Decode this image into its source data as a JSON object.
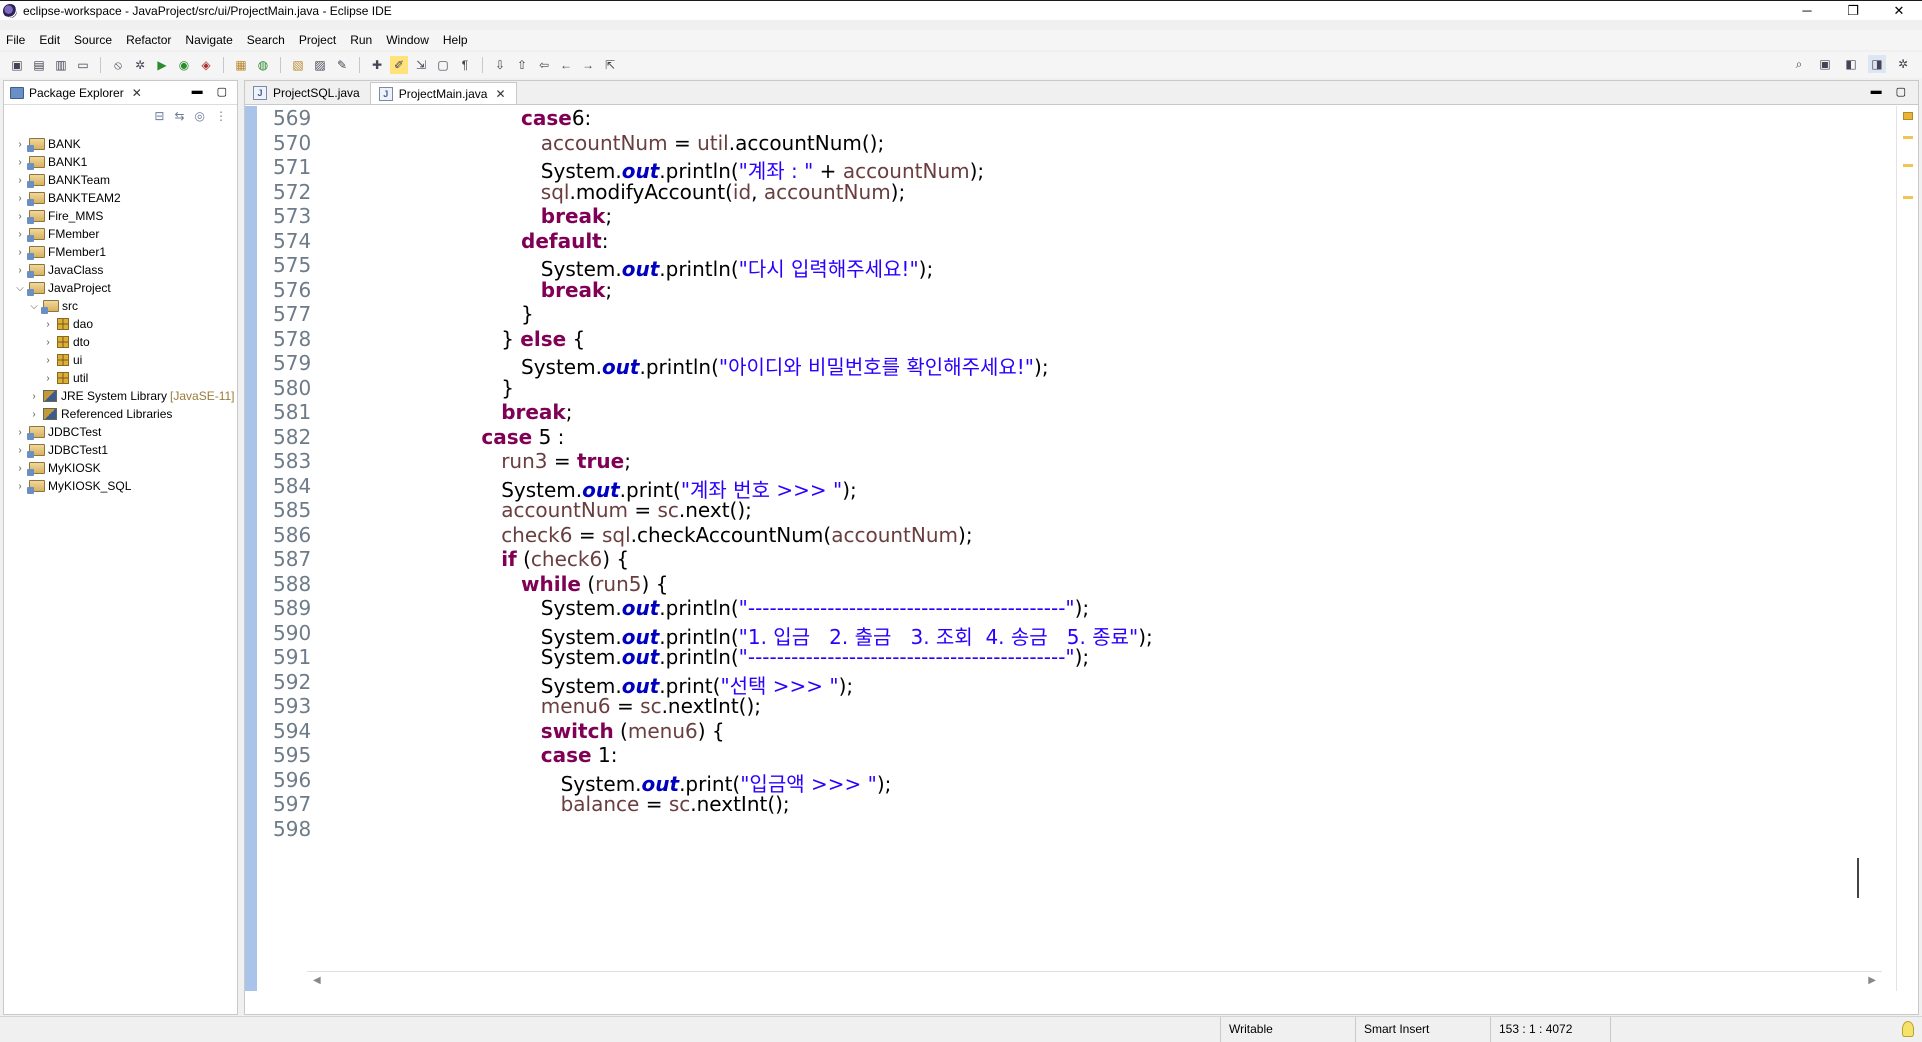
{
  "window": {
    "title": "eclipse-workspace - JavaProject/src/ui/ProjectMain.java - Eclipse IDE",
    "minimize": "─",
    "restore": "❐",
    "close": "✕"
  },
  "menu": [
    "File",
    "Edit",
    "Source",
    "Refactor",
    "Navigate",
    "Search",
    "Project",
    "Run",
    "Window",
    "Help"
  ],
  "package_explorer": {
    "tab_label": "Package Explorer",
    "items": [
      {
        "label": "BANK",
        "level": 0,
        "type": "project",
        "expanded": false
      },
      {
        "label": "BANK1",
        "level": 0,
        "type": "project",
        "expanded": false
      },
      {
        "label": "BANKTeam",
        "level": 0,
        "type": "project",
        "expanded": false
      },
      {
        "label": "BANKTEAM2",
        "level": 0,
        "type": "project",
        "expanded": false
      },
      {
        "label": "Fire_MMS",
        "level": 0,
        "type": "project",
        "expanded": false
      },
      {
        "label": "FMember",
        "level": 0,
        "type": "project",
        "expanded": false
      },
      {
        "label": "FMember1",
        "level": 0,
        "type": "project",
        "expanded": false
      },
      {
        "label": "JavaClass",
        "level": 0,
        "type": "project",
        "expanded": false
      },
      {
        "label": "JavaProject",
        "level": 0,
        "type": "project",
        "expanded": true
      },
      {
        "label": "src",
        "level": 1,
        "type": "srcfolder",
        "expanded": true
      },
      {
        "label": "dao",
        "level": 2,
        "type": "package",
        "expanded": false
      },
      {
        "label": "dto",
        "level": 2,
        "type": "package",
        "expanded": false
      },
      {
        "label": "ui",
        "level": 2,
        "type": "package",
        "expanded": false
      },
      {
        "label": "util",
        "level": 2,
        "type": "package",
        "expanded": false
      },
      {
        "label": "JRE System Library",
        "version": "[JavaSE-11]",
        "level": 1,
        "type": "library",
        "expanded": false
      },
      {
        "label": "Referenced Libraries",
        "level": 1,
        "type": "library",
        "expanded": false
      },
      {
        "label": "JDBCTest",
        "level": 0,
        "type": "project",
        "expanded": false
      },
      {
        "label": "JDBCTest1",
        "level": 0,
        "type": "project",
        "expanded": false
      },
      {
        "label": "MyKIOSK",
        "level": 0,
        "type": "project",
        "expanded": false
      },
      {
        "label": "MyKIOSK_SQL",
        "level": 0,
        "type": "project",
        "expanded": false
      }
    ]
  },
  "editor": {
    "tabs": [
      {
        "label": "ProjectSQL.java",
        "active": false
      },
      {
        "label": "ProjectMain.java",
        "active": true
      }
    ],
    "lines": [
      {
        "num": "569",
        "indent": 10,
        "tokens": [
          [
            "kw",
            "case"
          ],
          [
            "",
            "6:"
          ]
        ]
      },
      {
        "num": "570",
        "indent": 11,
        "tokens": [
          [
            "vr",
            "accountNum"
          ],
          [
            "",
            " = "
          ],
          [
            "vr",
            "util"
          ],
          [
            "",
            ".accountNum();"
          ]
        ]
      },
      {
        "num": "571",
        "indent": 11,
        "tokens": [
          [
            "",
            "System."
          ],
          [
            "fld",
            "out"
          ],
          [
            "",
            ".println("
          ],
          [
            "st",
            "\"계좌 : \""
          ],
          [
            "",
            " + "
          ],
          [
            "vr",
            "accountNum"
          ],
          [
            "",
            ");"
          ]
        ]
      },
      {
        "num": "572",
        "indent": 11,
        "tokens": [
          [
            "vr",
            "sql"
          ],
          [
            "",
            ".modifyAccount("
          ],
          [
            "vr",
            "id"
          ],
          [
            "",
            ", "
          ],
          [
            "vr",
            "accountNum"
          ],
          [
            "",
            ");"
          ]
        ]
      },
      {
        "num": "573",
        "indent": 11,
        "tokens": [
          [
            "kw",
            "break"
          ],
          [
            "",
            ";"
          ]
        ]
      },
      {
        "num": "574",
        "indent": 10,
        "tokens": [
          [
            "kw",
            "default"
          ],
          [
            "",
            ":"
          ]
        ]
      },
      {
        "num": "575",
        "indent": 11,
        "tokens": [
          [
            "",
            "System."
          ],
          [
            "fld",
            "out"
          ],
          [
            "",
            ".println("
          ],
          [
            "st",
            "\"다시 입력해주세요!\""
          ],
          [
            "",
            ");"
          ]
        ]
      },
      {
        "num": "576",
        "indent": 11,
        "tokens": [
          [
            "kw",
            "break"
          ],
          [
            "",
            ";"
          ]
        ]
      },
      {
        "num": "577",
        "indent": 10,
        "tokens": [
          [
            "",
            "}"
          ]
        ]
      },
      {
        "num": "578",
        "indent": 9,
        "tokens": [
          [
            "",
            "} "
          ],
          [
            "kw",
            "else"
          ],
          [
            "",
            " {"
          ]
        ]
      },
      {
        "num": "579",
        "indent": 10,
        "tokens": [
          [
            "",
            "System."
          ],
          [
            "fld",
            "out"
          ],
          [
            "",
            ".println("
          ],
          [
            "st",
            "\"아이디와 비밀번호를 확인해주세요!\""
          ],
          [
            "",
            ");"
          ]
        ]
      },
      {
        "num": "580",
        "indent": 9,
        "tokens": [
          [
            "",
            "}"
          ]
        ]
      },
      {
        "num": "581",
        "indent": 9,
        "tokens": [
          [
            "kw",
            "break"
          ],
          [
            "",
            ";"
          ]
        ]
      },
      {
        "num": "582",
        "indent": 8,
        "tokens": [
          [
            "kw",
            "case"
          ],
          [
            "",
            " 5 :"
          ]
        ]
      },
      {
        "num": "583",
        "indent": 9,
        "tokens": [
          [
            "vr",
            "run3"
          ],
          [
            "",
            " = "
          ],
          [
            "kw",
            "true"
          ],
          [
            "",
            ";"
          ]
        ]
      },
      {
        "num": "584",
        "indent": 9,
        "tokens": [
          [
            "",
            "System."
          ],
          [
            "fld",
            "out"
          ],
          [
            "",
            ".print("
          ],
          [
            "st",
            "\"계좌 번호 >>> \""
          ],
          [
            "",
            ");"
          ]
        ]
      },
      {
        "num": "585",
        "indent": 9,
        "tokens": [
          [
            "vr",
            "accountNum"
          ],
          [
            "",
            " = "
          ],
          [
            "vr",
            "sc"
          ],
          [
            "",
            ".next();"
          ]
        ]
      },
      {
        "num": "586",
        "indent": 9,
        "tokens": [
          [
            "vr",
            "check6"
          ],
          [
            "",
            " = "
          ],
          [
            "vr",
            "sql"
          ],
          [
            "",
            ".checkAccountNum("
          ],
          [
            "vr",
            "accountNum"
          ],
          [
            "",
            ");"
          ]
        ]
      },
      {
        "num": "587",
        "indent": 9,
        "tokens": [
          [
            "kw",
            "if"
          ],
          [
            "",
            " ("
          ],
          [
            "vr",
            "check6"
          ],
          [
            "",
            ") {"
          ]
        ]
      },
      {
        "num": "588",
        "indent": 10,
        "tokens": [
          [
            "kw",
            "while"
          ],
          [
            "",
            " ("
          ],
          [
            "vr",
            "run5"
          ],
          [
            "",
            ") {"
          ]
        ]
      },
      {
        "num": "589",
        "indent": 11,
        "tokens": [
          [
            "",
            "System."
          ],
          [
            "fld",
            "out"
          ],
          [
            "",
            ".println("
          ],
          [
            "st",
            "\"--------------------------------------------\""
          ],
          [
            "",
            ");"
          ]
        ]
      },
      {
        "num": "590",
        "indent": 11,
        "tokens": [
          [
            "",
            "System."
          ],
          [
            "fld",
            "out"
          ],
          [
            "",
            ".println("
          ],
          [
            "st",
            "\"1. 입금   2. 출금   3. 조회  4. 송금   5. 종료\""
          ],
          [
            "",
            ");"
          ]
        ]
      },
      {
        "num": "591",
        "indent": 11,
        "tokens": [
          [
            "",
            "System."
          ],
          [
            "fld",
            "out"
          ],
          [
            "",
            ".println("
          ],
          [
            "st",
            "\"--------------------------------------------\""
          ],
          [
            "",
            ");"
          ]
        ]
      },
      {
        "num": "592",
        "indent": 11,
        "tokens": [
          [
            "",
            "System."
          ],
          [
            "fld",
            "out"
          ],
          [
            "",
            ".print("
          ],
          [
            "st",
            "\"선택 >>> \""
          ],
          [
            "",
            ");"
          ]
        ]
      },
      {
        "num": "593",
        "indent": 11,
        "tokens": [
          [
            "vr",
            "menu6"
          ],
          [
            "",
            " = "
          ],
          [
            "vr",
            "sc"
          ],
          [
            "",
            ".nextInt();"
          ]
        ]
      },
      {
        "num": "594",
        "indent": 11,
        "tokens": [
          [
            "kw",
            "switch"
          ],
          [
            "",
            " ("
          ],
          [
            "vr",
            "menu6"
          ],
          [
            "",
            ") {"
          ]
        ]
      },
      {
        "num": "595",
        "indent": 11,
        "tokens": [
          [
            "kw",
            "case"
          ],
          [
            "",
            " 1:"
          ]
        ]
      },
      {
        "num": "596",
        "indent": 12,
        "tokens": [
          [
            "",
            "System."
          ],
          [
            "fld",
            "out"
          ],
          [
            "",
            ".print("
          ],
          [
            "st",
            "\"입금액 >>> \""
          ],
          [
            "",
            ");"
          ]
        ]
      },
      {
        "num": "597",
        "indent": 12,
        "tokens": [
          [
            "vr",
            "balance"
          ],
          [
            "",
            " = "
          ],
          [
            "vr",
            "sc"
          ],
          [
            "",
            ".nextInt();"
          ]
        ]
      },
      {
        "num": "598",
        "indent": 0,
        "tokens": []
      }
    ]
  },
  "status": {
    "writable": "Writable",
    "insert_mode": "Smart Insert",
    "position": "153 : 1 : 4072"
  }
}
